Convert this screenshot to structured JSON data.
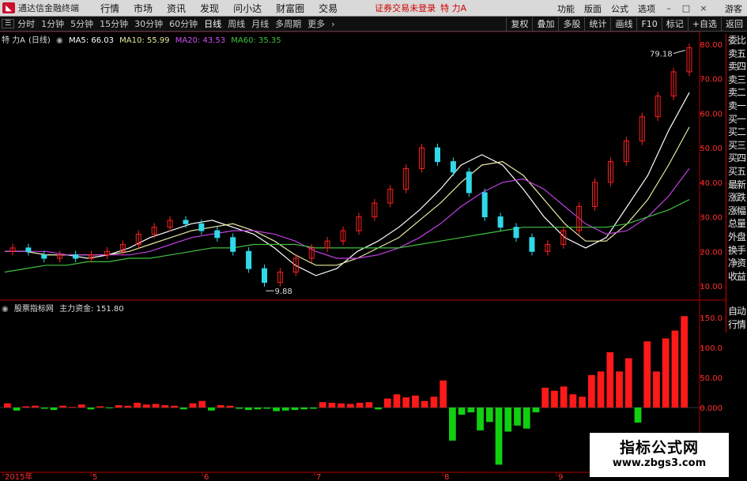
{
  "menubar": {
    "app_name": "通达信金融终端",
    "items": [
      "行情",
      "市场",
      "资讯",
      "发现",
      "问小达",
      "财富圈",
      "交易"
    ],
    "warning": "证券交易未登录",
    "stock_title": "特 力A",
    "right_items": [
      "功能",
      "版面",
      "公式",
      "选项"
    ],
    "user": "游客"
  },
  "toolbar": {
    "periods": [
      "分时",
      "1分钟",
      "5分钟",
      "15分钟",
      "30分钟",
      "60分钟",
      "日线",
      "周线",
      "月线",
      "多周期",
      "更多"
    ],
    "active_period": "日线",
    "right_buttons": [
      "复权",
      "叠加",
      "多股",
      "统计",
      "画线",
      "F10",
      "标记",
      "+自选",
      "返回"
    ]
  },
  "price_legend": {
    "stock": "特 力A",
    "period_tag": "(日线)",
    "ma5": "MA5: 66.03",
    "ma10": "MA10: 55.99",
    "ma20": "MA20: 43.53",
    "ma60": "MA60: 35.35"
  },
  "indicator_legend": {
    "name": "股票指标网",
    "label": "主力资金: 151.80"
  },
  "price_axis": [
    "80.00",
    "70.00",
    "60.00",
    "50.00",
    "40.00",
    "30.00",
    "20.00",
    "10.00"
  ],
  "indicator_axis": [
    "150.0",
    "100.0",
    "50.00",
    "0.000"
  ],
  "x_axis": [
    "2015年",
    "5",
    "6",
    "7",
    "8",
    "9"
  ],
  "annotations": {
    "high": "79.18",
    "low": "9.88"
  },
  "side_tabs": [
    "委比",
    "卖五",
    "卖四",
    "卖三",
    "卖二",
    "卖一",
    "买一",
    "买二",
    "买三",
    "买四",
    "买五",
    "最新",
    "涨跌",
    "涨幅",
    "总量",
    "外盘",
    "换手",
    "净资",
    "收益"
  ],
  "side_tabs_2": [
    "自动",
    "行情"
  ],
  "watermark": {
    "line1": "指标公式网",
    "line2": "www.zbgs3.com"
  },
  "colors": {
    "up": "#ff2020",
    "down": "#30d8e8",
    "ma5": "#ffffff",
    "ma10": "#e8e8a0",
    "ma20": "#c040e0",
    "ma60": "#40c040",
    "money_up": "#ff1a1a",
    "money_down": "#10d010"
  },
  "chart_data": [
    {
      "type": "line",
      "title": "特 力A (日线)",
      "ylim": [
        10,
        80
      ],
      "series": [
        {
          "name": "MA5",
          "values": [
            20,
            20,
            19,
            19,
            18,
            19,
            21,
            24,
            26,
            28,
            29,
            27,
            25,
            21,
            16,
            13,
            15,
            20,
            23,
            27,
            32,
            38,
            45,
            48,
            45,
            38,
            30,
            24,
            21,
            24,
            33,
            42,
            55,
            66
          ]
        },
        {
          "name": "MA10",
          "values": [
            20,
            20,
            19,
            19,
            19,
            19,
            20,
            22,
            24,
            26,
            27,
            28,
            26,
            23,
            19,
            16,
            16,
            18,
            21,
            24,
            29,
            34,
            40,
            45,
            46,
            42,
            35,
            28,
            23,
            23,
            28,
            35,
            45,
            56
          ]
        },
        {
          "name": "MA20",
          "values": [
            20,
            20,
            20,
            19,
            19,
            19,
            19,
            20,
            22,
            24,
            25,
            26,
            26,
            25,
            23,
            20,
            18,
            18,
            19,
            21,
            24,
            28,
            33,
            37,
            40,
            41,
            38,
            33,
            28,
            25,
            26,
            30,
            36,
            44
          ]
        },
        {
          "name": "MA60",
          "values": [
            14,
            15,
            16,
            16,
            17,
            17,
            18,
            18,
            19,
            20,
            21,
            21,
            22,
            22,
            22,
            21,
            21,
            21,
            21,
            21,
            22,
            23,
            24,
            25,
            26,
            27,
            27,
            27,
            27,
            27,
            28,
            30,
            32,
            35
          ]
        }
      ],
      "candles": [
        {
          "o": 20,
          "c": 21
        },
        {
          "o": 21,
          "c": 20
        },
        {
          "o": 19,
          "c": 18
        },
        {
          "o": 18,
          "c": 19
        },
        {
          "o": 19,
          "c": 18
        },
        {
          "o": 18,
          "c": 19
        },
        {
          "o": 19,
          "c": 20
        },
        {
          "o": 20,
          "c": 22
        },
        {
          "o": 22,
          "c": 25
        },
        {
          "o": 25,
          "c": 27
        },
        {
          "o": 27,
          "c": 29
        },
        {
          "o": 29,
          "c": 28
        },
        {
          "o": 28,
          "c": 26
        },
        {
          "o": 26,
          "c": 24
        },
        {
          "o": 24,
          "c": 20
        },
        {
          "o": 20,
          "c": 15
        },
        {
          "o": 15,
          "c": 11
        },
        {
          "o": 11,
          "c": 14
        },
        {
          "o": 14,
          "c": 18
        },
        {
          "o": 18,
          "c": 21
        },
        {
          "o": 21,
          "c": 23
        },
        {
          "o": 23,
          "c": 26
        },
        {
          "o": 26,
          "c": 30
        },
        {
          "o": 30,
          "c": 34
        },
        {
          "o": 34,
          "c": 38
        },
        {
          "o": 38,
          "c": 44
        },
        {
          "o": 44,
          "c": 50
        },
        {
          "o": 50,
          "c": 46
        },
        {
          "o": 46,
          "c": 43
        },
        {
          "o": 43,
          "c": 37
        },
        {
          "o": 37,
          "c": 30
        },
        {
          "o": 30,
          "c": 27
        },
        {
          "o": 27,
          "c": 24
        },
        {
          "o": 24,
          "c": 20
        },
        {
          "o": 20,
          "c": 22
        },
        {
          "o": 22,
          "c": 26
        },
        {
          "o": 26,
          "c": 33
        },
        {
          "o": 33,
          "c": 40
        },
        {
          "o": 40,
          "c": 46
        },
        {
          "o": 46,
          "c": 52
        },
        {
          "o": 52,
          "c": 59
        },
        {
          "o": 59,
          "c": 65
        },
        {
          "o": 65,
          "c": 72
        },
        {
          "o": 72,
          "c": 79
        }
      ]
    },
    {
      "type": "bar",
      "title": "主力资金",
      "ylim": [
        -100,
        155
      ],
      "values": [
        7,
        -5,
        2,
        3,
        -2,
        -4,
        3,
        1,
        5,
        -3,
        2,
        -1,
        4,
        3,
        8,
        5,
        6,
        4,
        3,
        -3,
        7,
        11,
        -5,
        4,
        3,
        -2,
        -4,
        -3,
        -2,
        -6,
        -5,
        -4,
        -3,
        -2,
        9,
        8,
        7,
        6,
        8,
        9,
        -3,
        15,
        22,
        17,
        20,
        11,
        18,
        45,
        -55,
        -12,
        -8,
        -38,
        -24,
        -95,
        -40,
        -30,
        -35,
        -8,
        33,
        28,
        35,
        22,
        18,
        54,
        60,
        92,
        60,
        82,
        -25,
        110,
        60,
        115,
        128,
        152
      ]
    }
  ]
}
